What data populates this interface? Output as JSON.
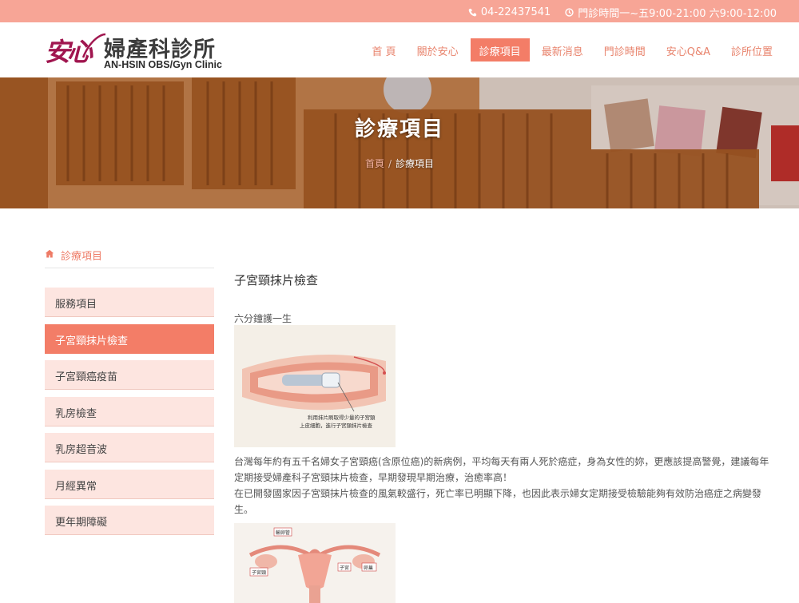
{
  "topbar": {
    "phone": "04-22437541",
    "hours": "門診時間一~五9:00-21:00 六9:00-12:00"
  },
  "logo": {
    "mark": "安心",
    "name": "婦產科診所",
    "english": "AN-HSIN OBS/Gyn Clinic"
  },
  "nav": {
    "items": [
      "首 頁",
      "關於安心",
      "診療項目",
      "最新消息",
      "門診時間",
      "安心Q&A",
      "診所位置"
    ],
    "active": "診療項目"
  },
  "banner": {
    "title": "診療項目",
    "breadcrumb_home": "首頁",
    "breadcrumb_sep": "/",
    "breadcrumb_current": "診療項目"
  },
  "sidebar": {
    "title": "診療項目",
    "items": [
      "服務項目",
      "子宮頸抹片檢查",
      "子宮頸癌疫苗",
      "乳房檢查",
      "乳房超音波",
      "月經異常",
      "更年期障礙"
    ],
    "active": "子宮頸抹片檢查"
  },
  "main": {
    "heading": "子宮頸抹片檢查",
    "subtitle": "六分鐘護一生",
    "image1_caption_line1": "利用抹片刷取得少量的子宮頸",
    "image1_caption_line2": "上皮細胞，進行子宮頸抹片檢查",
    "paragraph1": "台灣每年約有五千名婦女子宮頸癌(含原位癌)的新病例，平均每天有兩人死於癌症，身為女性的妳，更應該提高警覺，建議每年定期接受婦產科子宮頸抹片檢查，早期發現早期治療，治癒率高！",
    "paragraph2": "在已開發國家因子宮頸抹片檢查的風氣較盛行，死亡率已明顯下降，也因此表示婦女定期接受檢驗能夠有效防治癌症之病變發生。",
    "image2_labels": [
      "輸卵管",
      "子宮",
      "卵巢",
      "子宮頸"
    ]
  },
  "colors": {
    "topbar": "#f7a596",
    "accent": "#f37d67",
    "side_bg": "#fde5e0",
    "logo_mark": "#a0164f"
  }
}
